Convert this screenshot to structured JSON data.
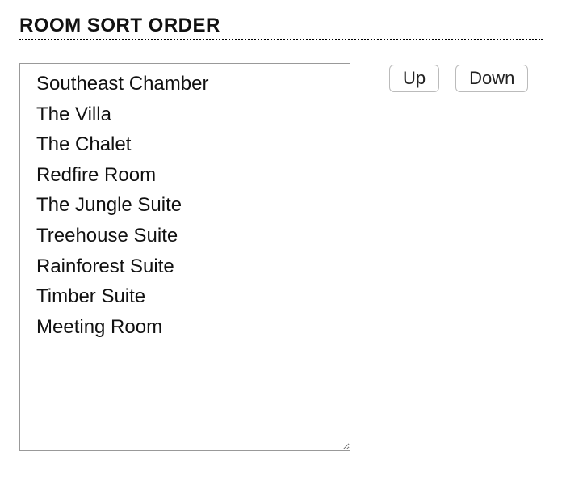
{
  "heading": "ROOM SORT ORDER",
  "buttons": {
    "up": "Up",
    "down": "Down"
  },
  "rooms": [
    "Southeast Chamber",
    "The Villa",
    "The Chalet",
    "Redfire Room",
    "The Jungle Suite",
    "Treehouse Suite",
    "Rainforest Suite",
    "Timber Suite",
    "Meeting Room"
  ]
}
